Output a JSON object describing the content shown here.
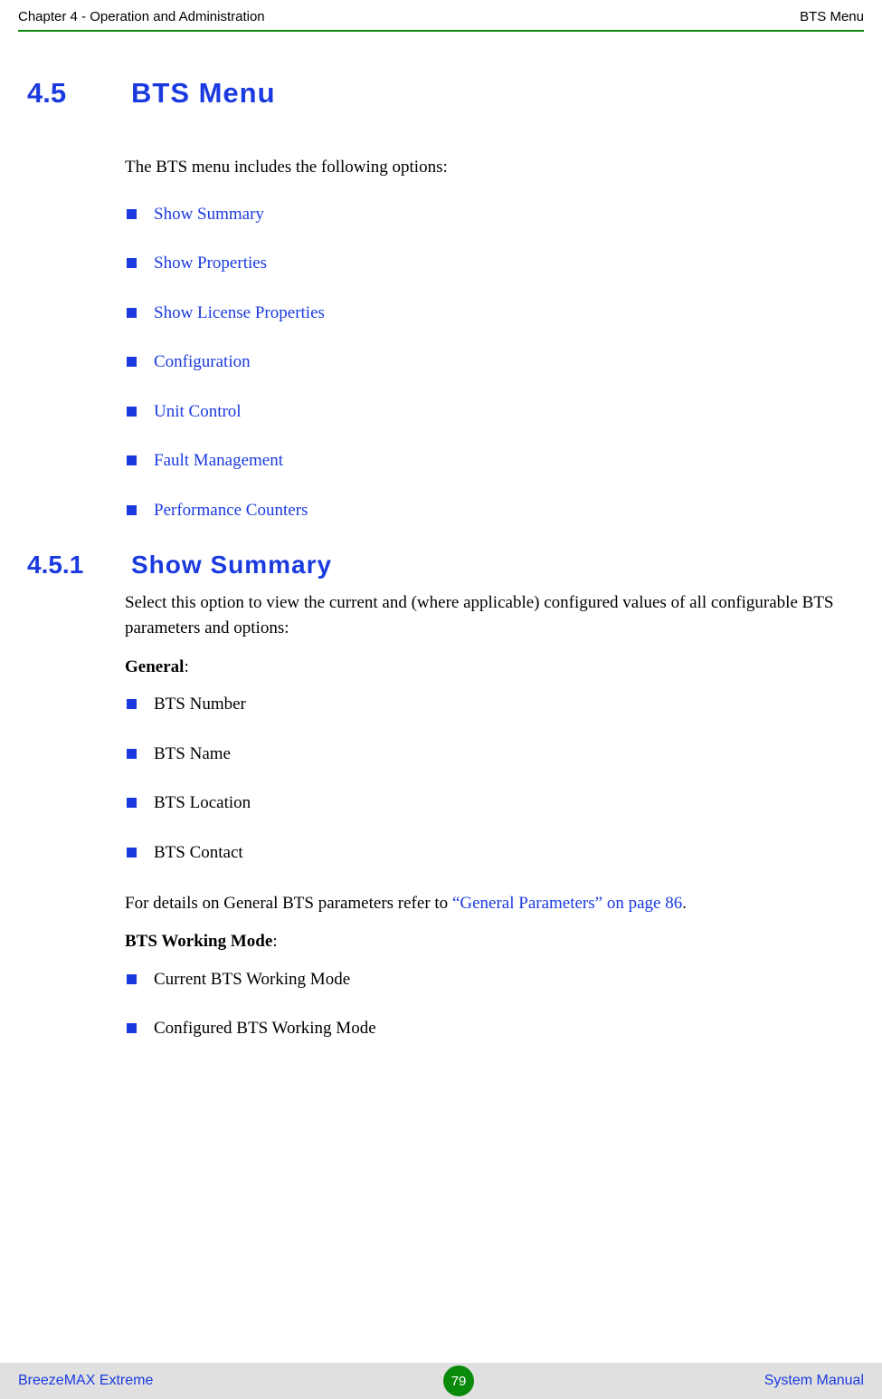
{
  "header": {
    "left": "Chapter 4 - Operation and Administration",
    "right": "BTS Menu"
  },
  "section": {
    "number": "4.5",
    "title": "BTS Menu"
  },
  "intro_paragraph": "The BTS menu includes the following options:",
  "menu_options": [
    "Show Summary",
    "Show Properties",
    "Show License Properties",
    "Configuration",
    "Unit Control",
    "Fault Management",
    "Performance Counters"
  ],
  "subsection": {
    "number": "4.5.1",
    "title": "Show Summary"
  },
  "subsection_intro": "Select this option to view the current and (where applicable) configured values of all configurable BTS parameters and options:",
  "general_label": "General",
  "general_items": [
    "BTS Number",
    "BTS Name",
    "BTS Location",
    "BTS Contact"
  ],
  "general_detail_prefix": "For details on General BTS parameters refer to ",
  "general_detail_link": "“General Parameters” on page 86",
  "general_detail_suffix": ".",
  "working_mode_label": "BTS Working Mode",
  "working_mode_items": [
    "Current BTS Working Mode",
    "Configured BTS Working Mode"
  ],
  "footer": {
    "left": "BreezeMAX Extreme",
    "page": "79",
    "right": "System Manual"
  }
}
